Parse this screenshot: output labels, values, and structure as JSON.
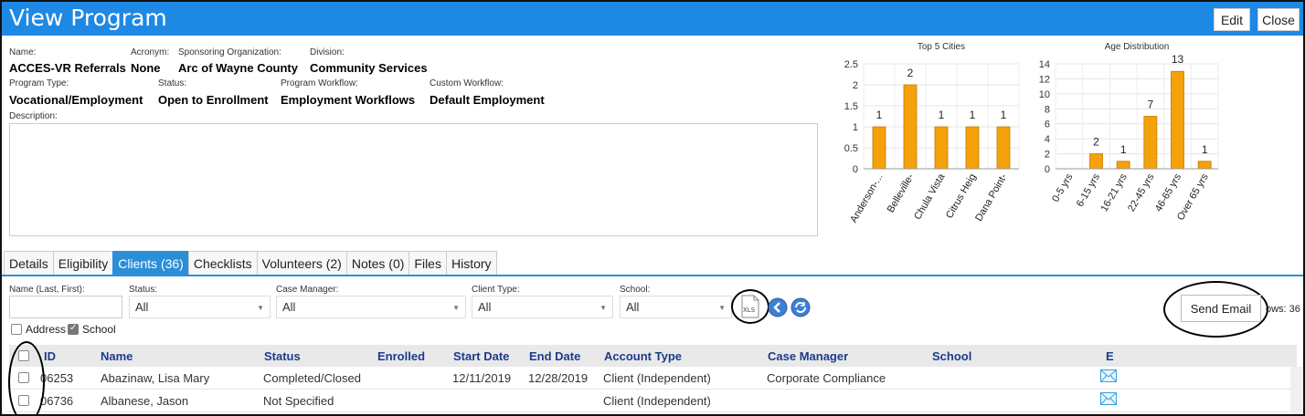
{
  "header": {
    "title": "View Program",
    "edit_label": "Edit",
    "close_label": "Close"
  },
  "info": {
    "name_label": "Name:",
    "name": "ACCES-VR Referrals",
    "acronym_label": "Acronym:",
    "acronym": "None",
    "sponsor_label": "Sponsoring Organization:",
    "sponsor": "Arc of Wayne County",
    "division_label": "Division:",
    "division": "Community Services",
    "type_label": "Program Type:",
    "type": "Vocational/Employment",
    "status_label": "Status:",
    "status": "Open to Enrollment",
    "workflow_label": "Program Workflow:",
    "workflow": "Employment Workflows",
    "custom_label": "Custom Workflow:",
    "custom": "Default Employment",
    "description_label": "Description:"
  },
  "chart_data": [
    {
      "type": "bar",
      "title": "Top 5 Cities",
      "categories": [
        "Anderson-...",
        "Belleville-",
        "Chula Vista",
        "Citrus Heig",
        "Dana Point-"
      ],
      "values": [
        1,
        2,
        1,
        1,
        1
      ],
      "ylim": [
        0,
        2.5
      ],
      "yticks": [
        "2.5",
        "2",
        "1.5",
        "1",
        "0.5",
        "0"
      ],
      "color": "#f5a10a",
      "grid": true
    },
    {
      "type": "bar",
      "title": "Age Distribution",
      "categories": [
        "0-5 yrs",
        "6-15 yrs",
        "16-21 yrs",
        "22-45 yrs",
        "46-65 yrs",
        "Over 65 yrs"
      ],
      "values": [
        0,
        2,
        1,
        7,
        13,
        1
      ],
      "data_labels": [
        "",
        "2",
        "1",
        "7",
        "13",
        "1"
      ],
      "ylim": [
        0,
        14
      ],
      "yticks": [
        "14",
        "12",
        "10",
        "8",
        "6",
        "4",
        "2",
        "0"
      ],
      "color": "#f5a10a",
      "grid": true
    }
  ],
  "tabs": [
    "Details",
    "Eligibility",
    "Clients (36)",
    "Checklists",
    "Volunteers (2)",
    "Notes (0)",
    "Files",
    "History"
  ],
  "filters": {
    "name_label": "Name (Last, First):",
    "status_label": "Status:",
    "status_value": "All",
    "case_manager_label": "Case Manager:",
    "case_manager_value": "All",
    "client_type_label": "Client Type:",
    "client_type_value": "All",
    "school_label": "School:",
    "school_value": "All",
    "address_label": "Address",
    "school_check_label": "School",
    "xls_text": "XLS",
    "send_email": "Send Email",
    "rows_text": "ows: 36"
  },
  "table": {
    "columns": [
      "ID",
      "Name",
      "Status",
      "Enrolled",
      "Start Date",
      "End Date",
      "Account Type",
      "Case Manager",
      "School",
      "E"
    ],
    "rows": [
      {
        "id": "06253",
        "name": "Abazinaw, Lisa Mary",
        "status": "Completed/Closed",
        "enrolled": "",
        "start": "12/11/2019",
        "end": "12/28/2019",
        "account": "Client (Independent)",
        "manager": "Corporate Compliance",
        "school": ""
      },
      {
        "id": "06736",
        "name": "Albanese, Jason",
        "status": "Not Specified",
        "enrolled": "",
        "start": "",
        "end": "",
        "account": "Client (Independent)",
        "manager": "",
        "school": ""
      }
    ]
  },
  "colors": {
    "header": "#1e88e5",
    "tab_active": "#2b8fd8",
    "bar": "#f5a10a",
    "column_header": "#1c3b8a"
  },
  "icons": [
    "xls-export-icon",
    "previous-arrow-icon",
    "refresh-icon",
    "email-icon",
    "checkbox-icon"
  ]
}
